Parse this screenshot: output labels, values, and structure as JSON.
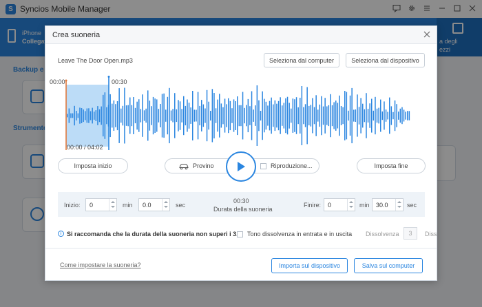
{
  "app": {
    "title": "Syncios Mobile Manager",
    "device_name": "iPhone",
    "device_status": "Collegat",
    "right_tab_line1": "a degli",
    "right_tab_line2": "ezzi",
    "section_backup": "Backup e r",
    "section_tools": "Strumento"
  },
  "dialog": {
    "title": "Crea suoneria",
    "file_name": "Leave The Door Open.mp3",
    "select_from_computer": "Seleziona dal computer",
    "select_from_device": "Seleziona dal dispositivo",
    "waveform": {
      "start_time": "00:00",
      "marker_time": "00:30",
      "position": "00:00 / 04:02",
      "selection_start_fraction": 0.0,
      "selection_end_fraction": 0.124
    },
    "set_start": "Imposta inizio",
    "set_end": "Imposta fine",
    "preview_label": "Provino",
    "loop_label": "Riproduzione...",
    "params": {
      "start_label": "Inizio:",
      "start_min": "0",
      "min_unit": "min",
      "start_sec": "0.0",
      "sec_unit": "sec",
      "duration_value": "00:30",
      "duration_label": "Durata della suoneria",
      "end_label": "Finire:",
      "end_min": "0",
      "end_sec": "30.0"
    },
    "recommendation": "Si raccomanda che la durata della suoneria non superi i 3...",
    "fade_label": "Tono dissolvenza in entrata e in uscita",
    "dissolve_label": "Dissolvenza",
    "dissolve_value": "3",
    "dissolve_label2": "Diss",
    "help_link": "Come impostare la suoneria?",
    "import_to_device": "Importa sul dispositivo",
    "save_to_computer": "Salva sul computer"
  },
  "colors": {
    "accent": "#2b86e0",
    "selection": "#bcdcf7",
    "playhead": "#e0793c"
  }
}
